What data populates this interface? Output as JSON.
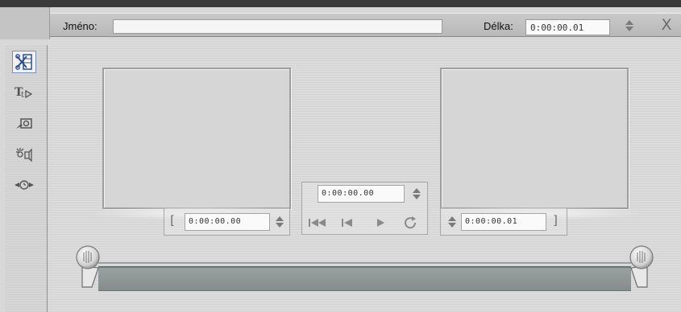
{
  "header": {
    "name_label": "Jméno:",
    "name_value": "",
    "length_label": "Délka:",
    "length_value": "0:00:00.01",
    "close_label": "X"
  },
  "sidebar": {
    "tools": [
      {
        "icon": "video-trim-icon",
        "active": true
      },
      {
        "icon": "title-icon",
        "active": false
      },
      {
        "icon": "camera-icon",
        "active": false
      },
      {
        "icon": "effects-icon",
        "active": false
      },
      {
        "icon": "speed-icon",
        "active": false
      }
    ]
  },
  "trim": {
    "in_timecode": "0:00:00.00",
    "current_timecode": "0:00:00.00",
    "out_timecode": "0:00:00.01",
    "in_bracket": "[",
    "out_bracket": "]"
  },
  "transport": [
    "go-to-start-icon",
    "step-back-icon",
    "play-icon",
    "loop-icon"
  ],
  "scrubber": {
    "in_position": 0.0,
    "out_position": 1.0
  }
}
